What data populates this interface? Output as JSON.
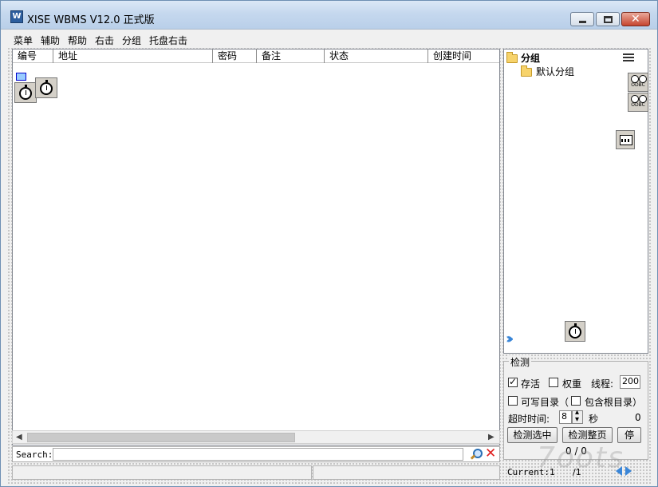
{
  "window": {
    "title": "XISE WBMS V12.0 正式版",
    "icon": "app-logo-icon"
  },
  "menu": [
    "菜单",
    "辅助",
    "帮助",
    "右击",
    "分组",
    "托盘右击"
  ],
  "table": {
    "columns": [
      "编号",
      "地址",
      "密码",
      "备注",
      "状态",
      "创建时间"
    ]
  },
  "search": {
    "label": "Search:",
    "value": ""
  },
  "tree": {
    "root": "分组",
    "children": [
      "默认分组"
    ]
  },
  "check": {
    "title": "检测",
    "alive_label": "存活",
    "alive_checked": true,
    "weight_label": "权重",
    "weight_checked": false,
    "threads_label": "线程:",
    "threads_value": "200",
    "writable_label": "可写目录（",
    "writable_checked": false,
    "include_root_label": "包含根目录）",
    "include_root_checked": false,
    "timeout_label": "超时时间:",
    "timeout_value": "8",
    "timeout_unit": "秒",
    "count_value": "0",
    "btn_selected": "检测选中",
    "btn_page": "检测整页",
    "btn_stop": "停",
    "progress": "0 / 0"
  },
  "pager": {
    "current_label": "Current:",
    "current_value": "1",
    "total": "/1"
  },
  "watermark": "7oots"
}
